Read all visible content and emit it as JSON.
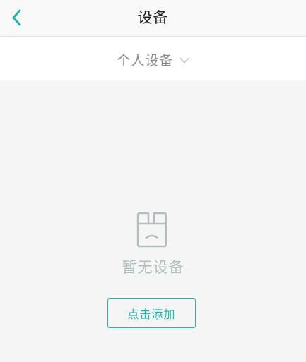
{
  "header": {
    "title": "设备",
    "back_icon": "chevron-left-icon"
  },
  "selector": {
    "label": "个人设备",
    "icon": "chevron-down-icon"
  },
  "empty_state": {
    "icon": "empty-box-icon",
    "message": "暂无设备",
    "action_label": "点击添加"
  },
  "colors": {
    "accent": "#1fb5a9",
    "background": "#f5f5f5",
    "header_bg": "#f9f9f9",
    "empty_text": "#b3bdbd"
  }
}
